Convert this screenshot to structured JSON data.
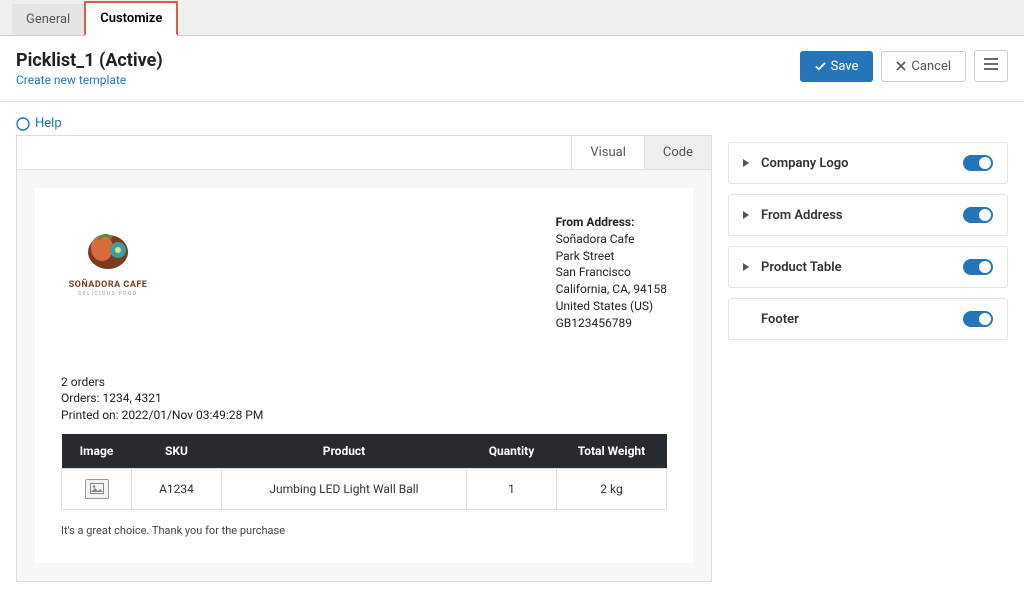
{
  "tabs": {
    "general": "General",
    "customize": "Customize"
  },
  "header": {
    "title": "Picklist_1 (Active)",
    "subtitle": "Create new template"
  },
  "buttons": {
    "save": "Save",
    "cancel": "Cancel"
  },
  "help": "Help",
  "preview_tabs": {
    "visual": "Visual",
    "code": "Code"
  },
  "paper": {
    "logo_title": "SOÑADORA CAFE",
    "logo_sub": "DELICIOUS FOOD",
    "from_label": "From Address:",
    "from_lines": [
      "Soñadora Cafe",
      "Park Street",
      "San Francisco",
      "California, CA, 94158",
      "United States (US)",
      "GB123456789"
    ],
    "meta": [
      "2 orders",
      "Orders: 1234, 4321",
      "Printed on: 2022/01/Nov 03:49:28 PM"
    ],
    "columns": [
      "Image",
      "SKU",
      "Product",
      "Quantity",
      "Total Weight"
    ],
    "row": {
      "sku": "A1234",
      "product": "Jumbing LED Light Wall Ball",
      "qty": "1",
      "weight": "2 kg"
    },
    "footer": "It's a great choice. Thank you for the purchase"
  },
  "panel": {
    "items": [
      {
        "label": "Company Logo",
        "expandable": true
      },
      {
        "label": "From Address",
        "expandable": true
      },
      {
        "label": "Product Table",
        "expandable": true
      },
      {
        "label": "Footer",
        "expandable": false
      }
    ]
  }
}
